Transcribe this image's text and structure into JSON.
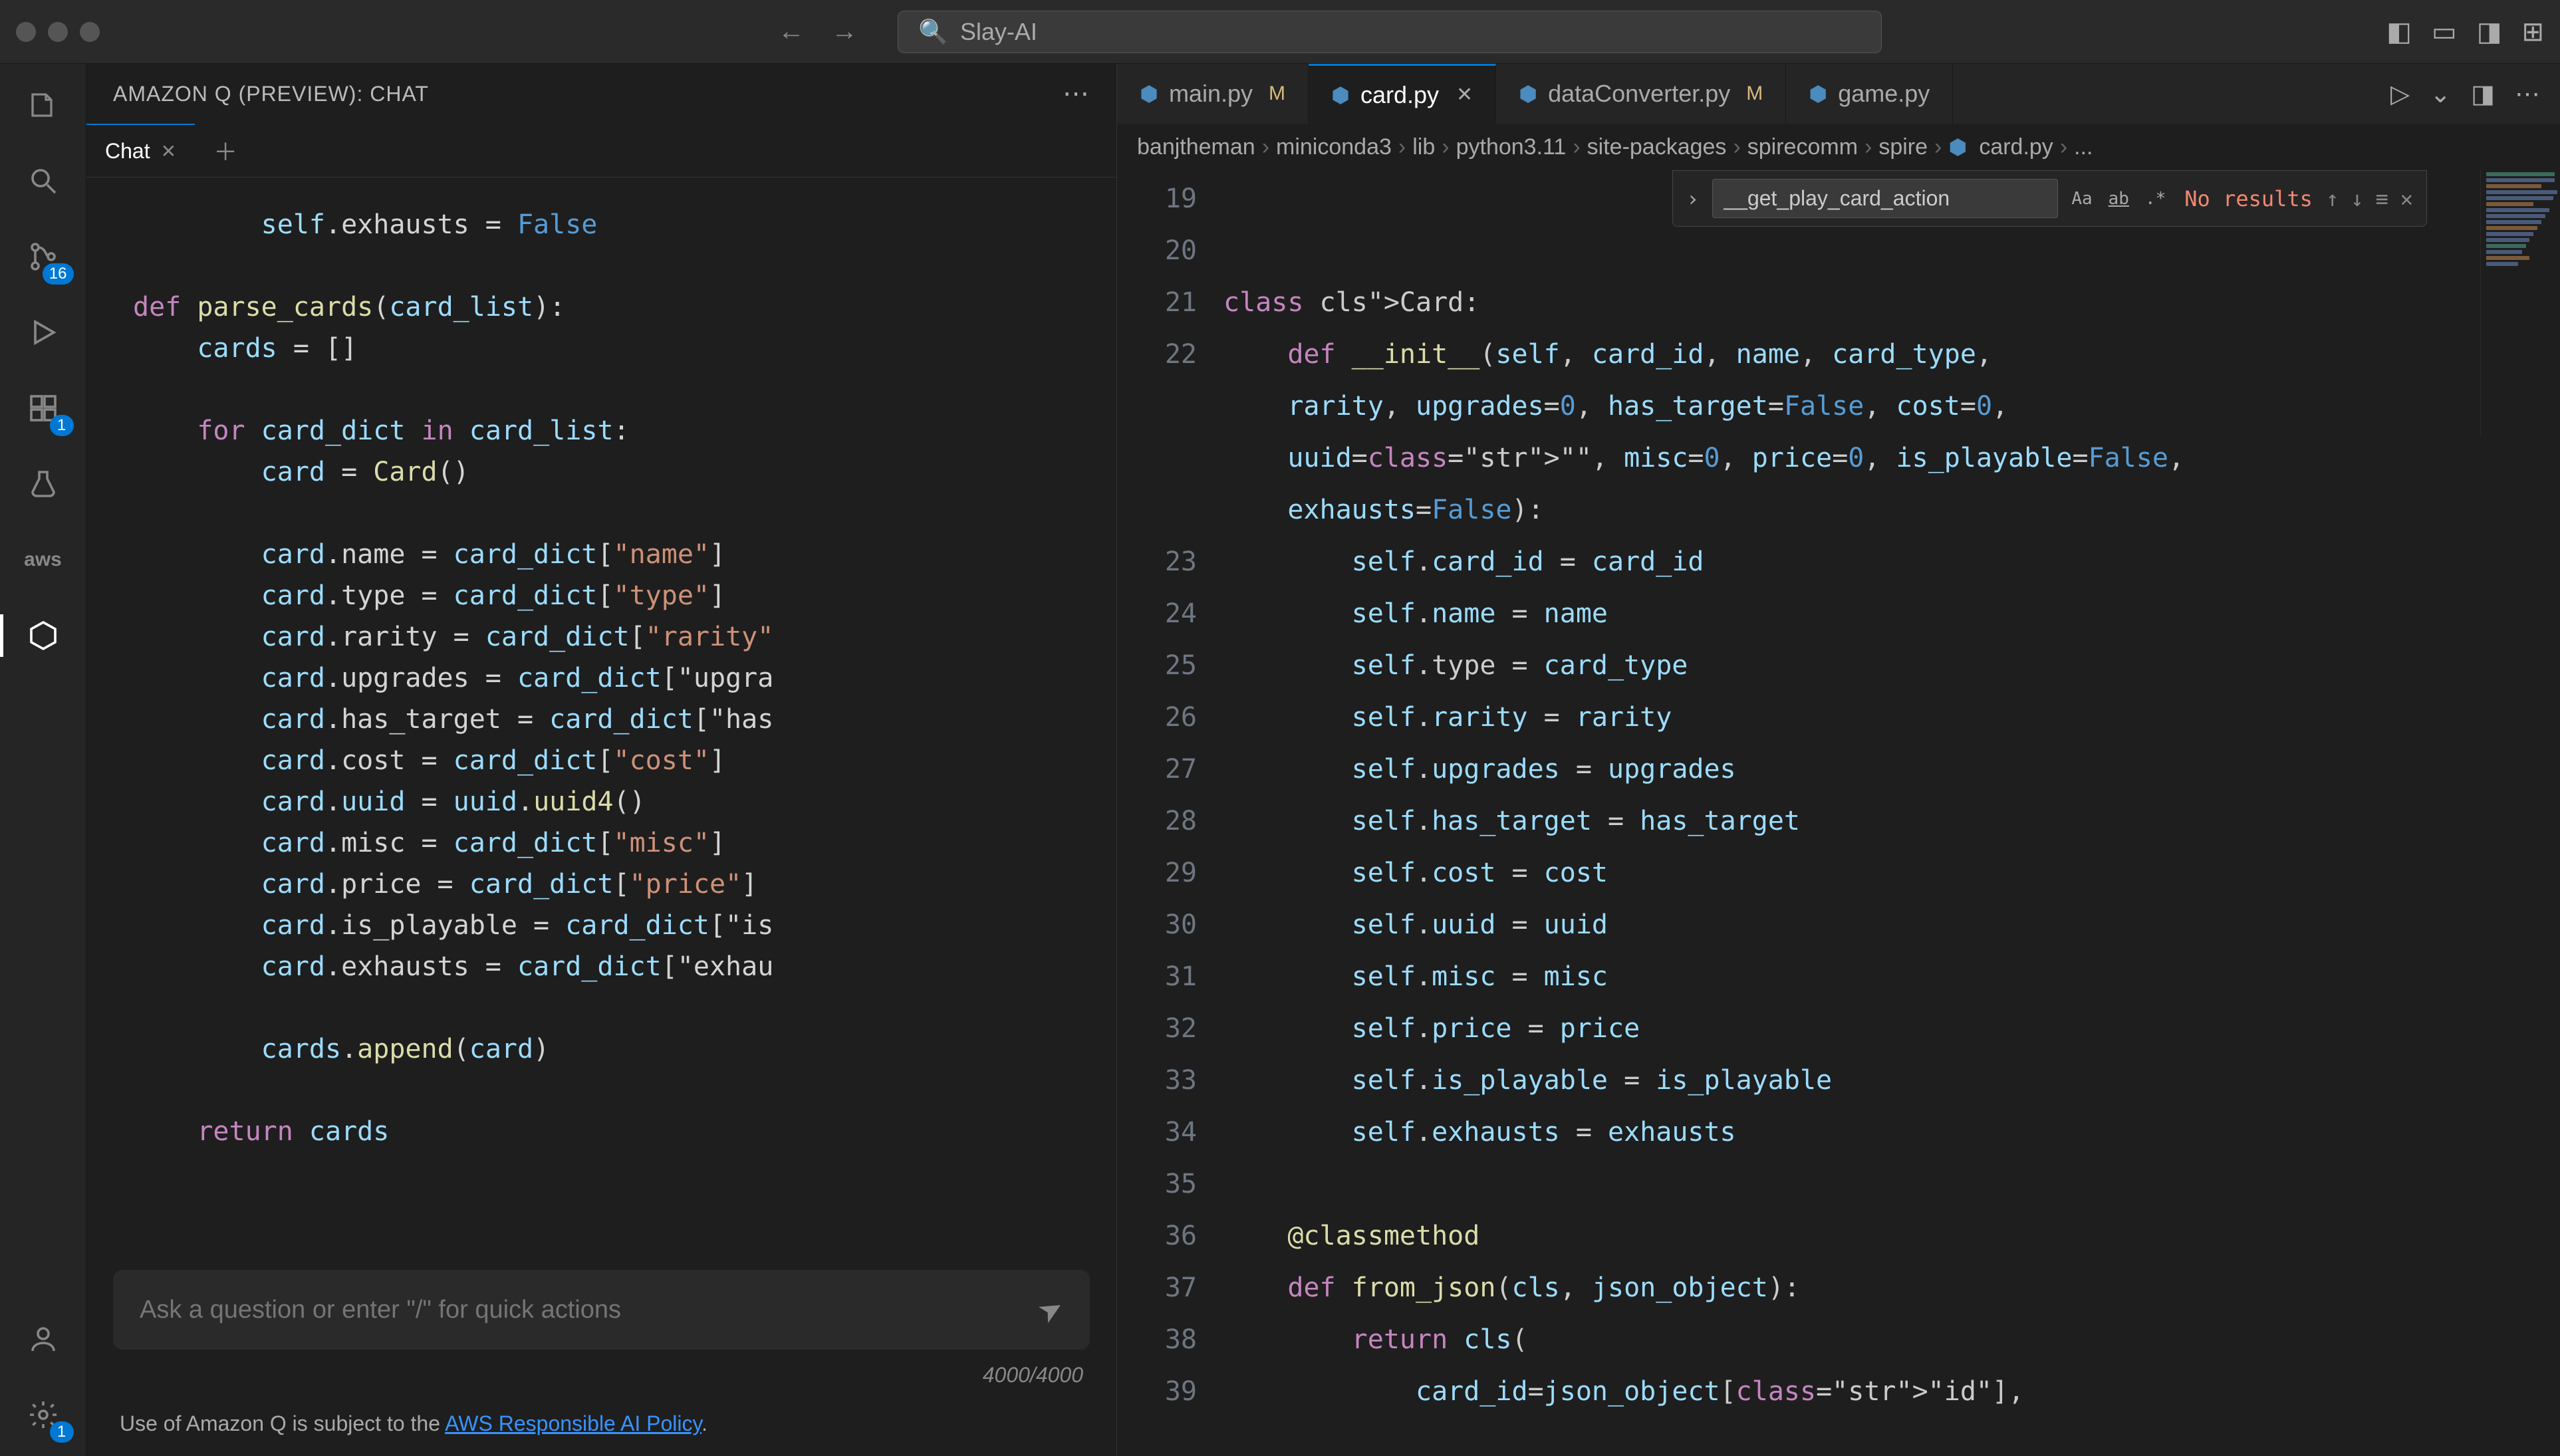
{
  "titlebar": {
    "search_text": "Slay-AI"
  },
  "activity": {
    "scm_badge": "16",
    "ext_badge": "1",
    "settings_badge": "1"
  },
  "sidebar": {
    "title": "AMAZON Q (PREVIEW): CHAT",
    "chat_tab_label": "Chat",
    "snippet_lines": [
      "        self.exhausts = False",
      "",
      "def parse_cards(card_list):",
      "    cards = []",
      "",
      "    for card_dict in card_list:",
      "        card = Card()",
      "",
      "        card.name = card_dict[\"name\"]",
      "        card.type = card_dict[\"type\"]",
      "        card.rarity = card_dict[\"rarity\"",
      "        card.upgrades = card_dict[\"upgra",
      "        card.has_target = card_dict[\"has",
      "        card.cost = card_dict[\"cost\"]",
      "        card.uuid = uuid.uuid4()",
      "        card.misc = card_dict[\"misc\"]",
      "        card.price = card_dict[\"price\"]",
      "        card.is_playable = card_dict[\"is",
      "        card.exhausts = card_dict[\"exhau",
      "",
      "        cards.append(card)",
      "",
      "    return cards"
    ],
    "input_placeholder": "Ask a question or enter \"/\" for quick actions",
    "counter": "4000/4000",
    "footer_prefix": "Use of Amazon Q is subject to the ",
    "footer_link": "AWS Responsible AI Policy",
    "footer_suffix": "."
  },
  "editor_tabs": [
    {
      "name": "main.py",
      "modified": "M",
      "active": false
    },
    {
      "name": "card.py",
      "modified": "",
      "active": true
    },
    {
      "name": "dataConverter.py",
      "modified": "M",
      "active": false
    },
    {
      "name": "game.py",
      "modified": "",
      "active": false
    }
  ],
  "breadcrumb": [
    "banjtheman",
    "miniconda3",
    "lib",
    "python3.11",
    "site-packages",
    "spirecomm",
    "spire",
    "card.py",
    "..."
  ],
  "find": {
    "value": "__get_play_card_action",
    "result": "No results"
  },
  "gutter_lines": [
    "19",
    "20",
    "21",
    "22",
    "23",
    "24",
    "25",
    "26",
    "27",
    "28",
    "29",
    "30",
    "31",
    "32",
    "33",
    "34",
    "35",
    "36",
    "37",
    "38",
    "39"
  ],
  "code_lines": [
    "",
    "",
    "class Card:",
    "    def __init__(self, card_id, name, card_type,",
    "    rarity, upgrades=0, has_target=False, cost=0,",
    "    uuid=\"\", misc=0, price=0, is_playable=False,",
    "    exhausts=False):",
    "        self.card_id = card_id",
    "        self.name = name",
    "        self.type = card_type",
    "        self.rarity = rarity",
    "        self.upgrades = upgrades",
    "        self.has_target = has_target",
    "        self.cost = cost",
    "        self.uuid = uuid",
    "        self.misc = misc",
    "        self.price = price",
    "        self.is_playable = is_playable",
    "        self.exhausts = exhausts",
    "",
    "    @classmethod",
    "    def from_json(cls, json_object):",
    "        return cls(",
    "            card_id=json_object[\"id\"],"
  ]
}
